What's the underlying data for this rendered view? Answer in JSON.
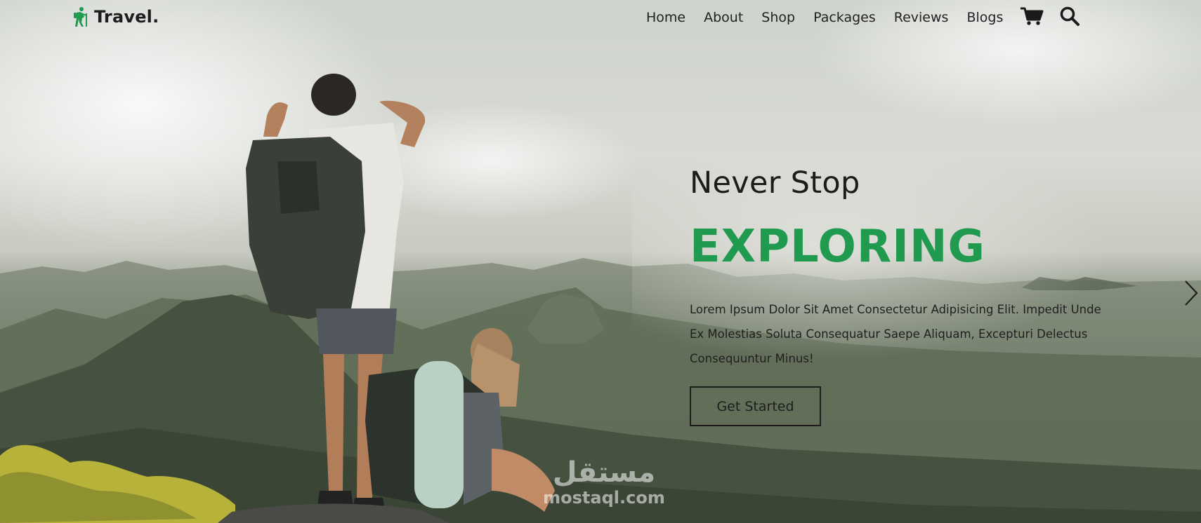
{
  "brand": {
    "name": "Travel.",
    "accent_color": "#1f9a4e",
    "logo_icon": "hiker-icon"
  },
  "nav": {
    "items": [
      {
        "label": "Home"
      },
      {
        "label": "About"
      },
      {
        "label": "Shop"
      },
      {
        "label": "Packages"
      },
      {
        "label": "Reviews"
      },
      {
        "label": "Blogs"
      }
    ],
    "cart_icon": "shopping-cart-icon",
    "search_icon": "search-icon"
  },
  "hero": {
    "subtitle": "Never Stop",
    "title": "EXPLORING",
    "description": "Lorem Ipsum Dolor Sit Amet Consectetur Adipisicing Elit. Impedit Unde Ex Molestias Soluta Consequatur Saepe Aliquam, Excepturi Delectus Consequuntur Minus!",
    "cta_label": "Get Started",
    "next_icon": "chevron-right-icon"
  },
  "watermark": {
    "text_arabic": "مستقل",
    "text_latin": "mostaql.com"
  }
}
